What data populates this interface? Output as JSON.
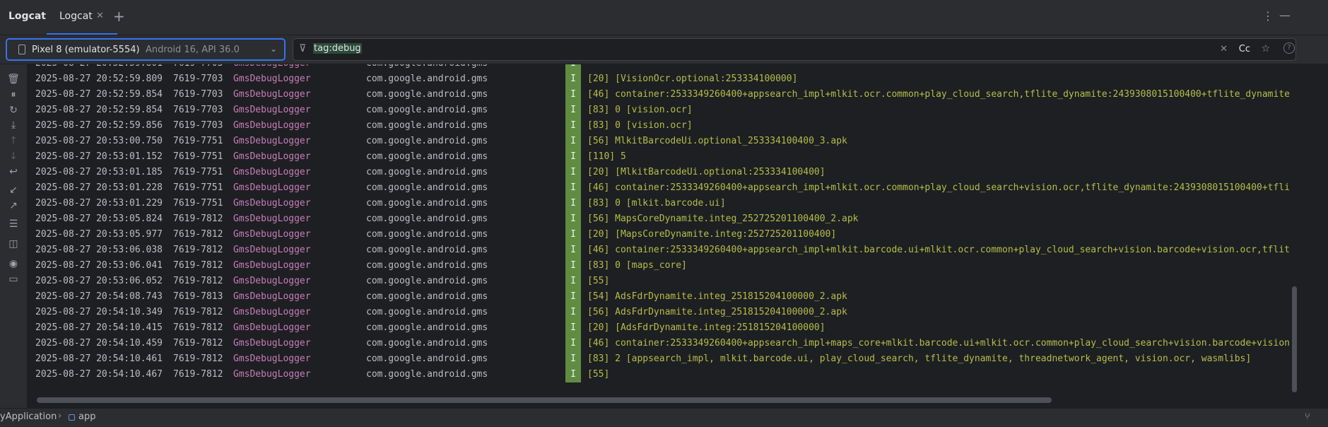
{
  "toolwindow": {
    "title": "Logcat",
    "tabs": [
      {
        "label": "Logcat"
      }
    ],
    "close_glyph": "✕",
    "add_glyph": "+",
    "more_glyph": "⋮",
    "minimize_glyph": "—"
  },
  "device": {
    "name": "Pixel 8 (emulator-5554)",
    "api": "Android 16, API 36.0"
  },
  "filter": {
    "query": "tag:debug",
    "case_label": "Cc"
  },
  "logs": [
    {
      "time": "2025-08-27 20:52:59.809",
      "pid": "7619-7703",
      "tag": "GmsDebugLogger",
      "package": "com.google.android.gms",
      "level": "I",
      "message": "[20] [VisionOcr.optional:253334100000]"
    },
    {
      "time": "2025-08-27 20:52:59.854",
      "pid": "7619-7703",
      "tag": "GmsDebugLogger",
      "package": "com.google.android.gms",
      "level": "I",
      "message": "[46] container:2533349260400+appsearch_impl+mlkit.ocr.common+play_cloud_search,tflite_dynamite:2439308015100400+tflite_dynamite"
    },
    {
      "time": "2025-08-27 20:52:59.854",
      "pid": "7619-7703",
      "tag": "GmsDebugLogger",
      "package": "com.google.android.gms",
      "level": "I",
      "message": "[83] 0 [vision.ocr]"
    },
    {
      "time": "2025-08-27 20:52:59.856",
      "pid": "7619-7703",
      "tag": "GmsDebugLogger",
      "package": "com.google.android.gms",
      "level": "I",
      "message": "[83] 0 [vision.ocr]"
    },
    {
      "time": "2025-08-27 20:53:00.750",
      "pid": "7619-7751",
      "tag": "GmsDebugLogger",
      "package": "com.google.android.gms",
      "level": "I",
      "message": "[56] MlkitBarcodeUi.optional_253334100400_3.apk"
    },
    {
      "time": "2025-08-27 20:53:01.152",
      "pid": "7619-7751",
      "tag": "GmsDebugLogger",
      "package": "com.google.android.gms",
      "level": "I",
      "message": "[110] 5"
    },
    {
      "time": "2025-08-27 20:53:01.185",
      "pid": "7619-7751",
      "tag": "GmsDebugLogger",
      "package": "com.google.android.gms",
      "level": "I",
      "message": "[20] [MlkitBarcodeUi.optional:253334100400]"
    },
    {
      "time": "2025-08-27 20:53:01.228",
      "pid": "7619-7751",
      "tag": "GmsDebugLogger",
      "package": "com.google.android.gms",
      "level": "I",
      "message": "[46] container:2533349260400+appsearch_impl+mlkit.ocr.common+play_cloud_search+vision.ocr,tflite_dynamite:2439308015100400+tflit"
    },
    {
      "time": "2025-08-27 20:53:01.229",
      "pid": "7619-7751",
      "tag": "GmsDebugLogger",
      "package": "com.google.android.gms",
      "level": "I",
      "message": "[83] 0 [mlkit.barcode.ui]"
    },
    {
      "time": "2025-08-27 20:53:05.824",
      "pid": "7619-7812",
      "tag": "GmsDebugLogger",
      "package": "com.google.android.gms",
      "level": "I",
      "message": "[56] MapsCoreDynamite.integ_252725201100400_2.apk"
    },
    {
      "time": "2025-08-27 20:53:05.977",
      "pid": "7619-7812",
      "tag": "GmsDebugLogger",
      "package": "com.google.android.gms",
      "level": "I",
      "message": "[20] [MapsCoreDynamite.integ:252725201100400]"
    },
    {
      "time": "2025-08-27 20:53:06.038",
      "pid": "7619-7812",
      "tag": "GmsDebugLogger",
      "package": "com.google.android.gms",
      "level": "I",
      "message": "[46] container:2533349260400+appsearch_impl+mlkit.barcode.ui+mlkit.ocr.common+play_cloud_search+vision.barcode+vision.ocr,tflite"
    },
    {
      "time": "2025-08-27 20:53:06.041",
      "pid": "7619-7812",
      "tag": "GmsDebugLogger",
      "package": "com.google.android.gms",
      "level": "I",
      "message": "[83] 0 [maps_core]"
    },
    {
      "time": "2025-08-27 20:53:06.052",
      "pid": "7619-7812",
      "tag": "GmsDebugLogger",
      "package": "com.google.android.gms",
      "level": "I",
      "message": "[55]"
    },
    {
      "time": "2025-08-27 20:54:08.743",
      "pid": "7619-7813",
      "tag": "GmsDebugLogger",
      "package": "com.google.android.gms",
      "level": "I",
      "message": "[54] AdsFdrDynamite.integ_251815204100000_2.apk"
    },
    {
      "time": "2025-08-27 20:54:10.349",
      "pid": "7619-7812",
      "tag": "GmsDebugLogger",
      "package": "com.google.android.gms",
      "level": "I",
      "message": "[56] AdsFdrDynamite.integ_251815204100000_2.apk"
    },
    {
      "time": "2025-08-27 20:54:10.415",
      "pid": "7619-7812",
      "tag": "GmsDebugLogger",
      "package": "com.google.android.gms",
      "level": "I",
      "message": "[20] [AdsFdrDynamite.integ:251815204100000]"
    },
    {
      "time": "2025-08-27 20:54:10.459",
      "pid": "7619-7812",
      "tag": "GmsDebugLogger",
      "package": "com.google.android.gms",
      "level": "I",
      "message": "[46] container:2533349260400+appsearch_impl+maps_core+mlkit.barcode.ui+mlkit.ocr.common+play_cloud_search+vision.barcode+vision."
    },
    {
      "time": "2025-08-27 20:54:10.461",
      "pid": "7619-7812",
      "tag": "GmsDebugLogger",
      "package": "com.google.android.gms",
      "level": "I",
      "message": "[83] 2 [appsearch_impl, mlkit.barcode.ui, play_cloud_search, tflite_dynamite, threadnetwork_agent, vision.ocr, wasmlibs]"
    },
    {
      "time": "2025-08-27 20:54:10.467",
      "pid": "7619-7812",
      "tag": "GmsDebugLogger",
      "package": "com.google.android.gms",
      "level": "I",
      "message": "[55]"
    }
  ],
  "sidebar_icons": [
    "clear-icon",
    "pause-icon",
    "restart-icon",
    "scroll-to-end-icon",
    "up-icon",
    "down-icon",
    "soft-wrap-icon",
    "import-icon",
    "export-icon",
    "settings-icon",
    "split-panels-icon",
    "screenshot-icon",
    "screen-record-icon"
  ],
  "statusbar": {
    "crumb_project": "yApplication",
    "crumb_separator": "›",
    "crumb_module": "app"
  },
  "colors": {
    "background": "#1e1f22",
    "panel": "#2b2d30",
    "accent": "#3574f0",
    "tag": "#c77dbb",
    "message": "#b4be4a",
    "level_info_bg": "#5f8c41"
  }
}
